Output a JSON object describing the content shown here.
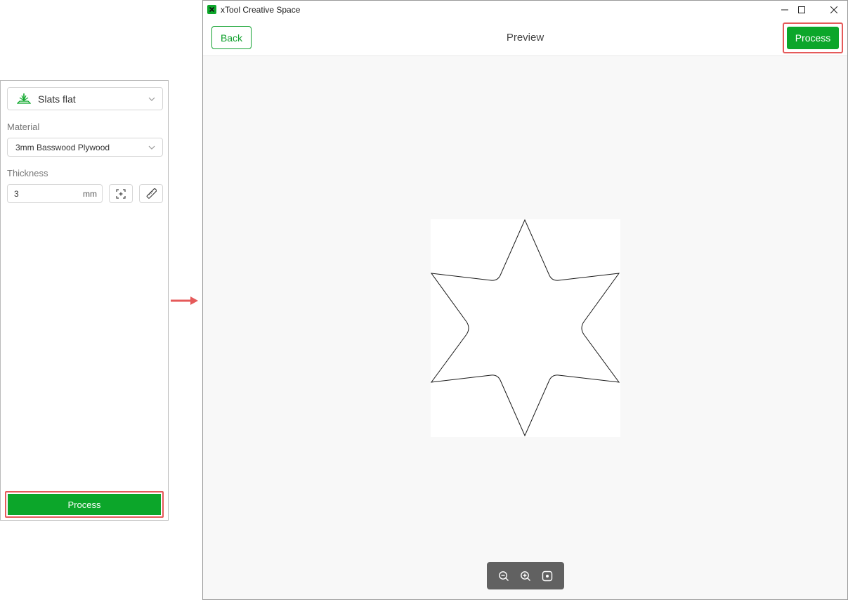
{
  "left_panel": {
    "mode": {
      "label": "Slats flat",
      "icon": "slats-flat-icon"
    },
    "material": {
      "label": "Material",
      "value": "3mm Basswood Plywood"
    },
    "thickness": {
      "label": "Thickness",
      "value": "3",
      "unit": "mm"
    },
    "process_label": "Process"
  },
  "window": {
    "title": "xTool Creative Space",
    "back_label": "Back",
    "preview_title": "Preview",
    "process_label": "Process"
  },
  "colors": {
    "accent_green": "#0ca62a",
    "highlight_red": "#e55a5a",
    "zoom_bar": "#616161"
  },
  "zoom_controls": [
    "zoom-out-icon",
    "zoom-in-icon",
    "fit-to-screen-icon"
  ]
}
